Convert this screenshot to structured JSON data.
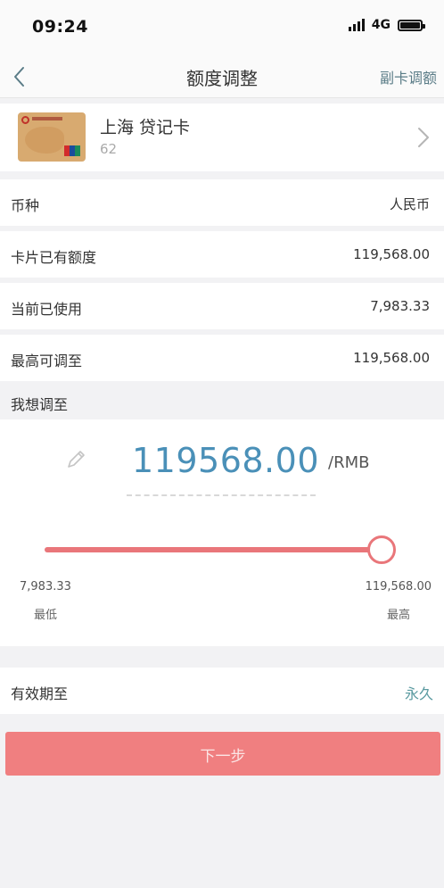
{
  "status_bar": {
    "time": "09:24",
    "network": "4G"
  },
  "nav": {
    "title": "额度调整",
    "right_action": "副卡调额"
  },
  "card": {
    "name": "上海 贷记卡",
    "number_prefix": "62",
    "thumbnail": "unionpay-credit-card",
    "card_color": "#d8aa70"
  },
  "info": {
    "currency": {
      "label": "币种",
      "value": "人民币"
    },
    "existing_limit": {
      "label": "卡片已有额度",
      "value": "119,568.00"
    },
    "used": {
      "label": "当前已使用",
      "value": "7,983.33"
    },
    "max_adjustable": {
      "label": "最高可调至",
      "value": "119,568.00"
    }
  },
  "adjust": {
    "section_title": "我想调至",
    "amount": "119568.00",
    "unit": "/RMB",
    "slider": {
      "min_value": "7,983.33",
      "max_value": "119,568.00",
      "min_caption": "最低",
      "max_caption": "最高",
      "fraction": 1.0
    }
  },
  "expiry": {
    "label": "有效期至",
    "value": "永久"
  },
  "next_button": {
    "label": "下一步"
  },
  "colors": {
    "accent": "#f07f80",
    "slider": "#e9767a",
    "amount": "#4a90b8",
    "link": "#5a7c87"
  }
}
